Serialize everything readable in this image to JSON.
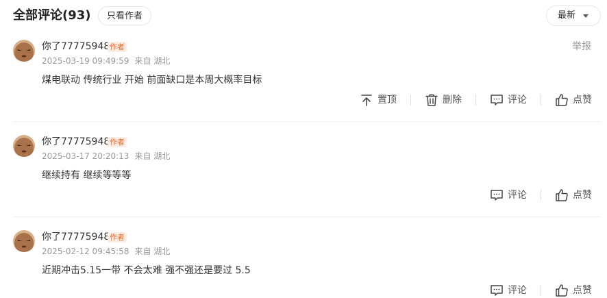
{
  "header": {
    "title": "全部评论(93)",
    "author_only_label": "只看作者",
    "sort_label": "最新"
  },
  "comments": [
    {
      "username": "你了77775948",
      "badge": "作者",
      "date": "2025-03-19 09:49:59",
      "location": "来自 湖北",
      "report": "举报",
      "text": "煤电联动 传统行业 开始 前面缺口是本周大概率目标",
      "actions": {
        "pin": "置顶",
        "delete": "删除",
        "comment": "评论",
        "like": "点赞"
      }
    },
    {
      "username": "你了77775948",
      "badge": "作者",
      "date": "2025-03-17 20:20:13",
      "location": "来自 湖北",
      "text": "继续持有 继续等等等",
      "actions": {
        "comment": "评论",
        "like": "点赞"
      }
    },
    {
      "username": "你了77775948",
      "badge": "作者",
      "date": "2025-02-12 09:45:58",
      "location": "来自 湖北",
      "text": "近期冲击5.15一带 不会太难 强不强还是要过 5.5",
      "actions": {
        "comment": "评论",
        "like": "点赞"
      }
    }
  ],
  "colors": {
    "badge_text": "#f06a28",
    "badge_bg": "#fdeee5",
    "meta_text": "#999999",
    "avatar_skin": "#a9724a"
  },
  "icons": {
    "pin": "pin-top-icon",
    "delete": "trash-icon",
    "comment": "comment-icon",
    "like": "thumbs-up-icon",
    "sort": "caret-down-icon"
  }
}
